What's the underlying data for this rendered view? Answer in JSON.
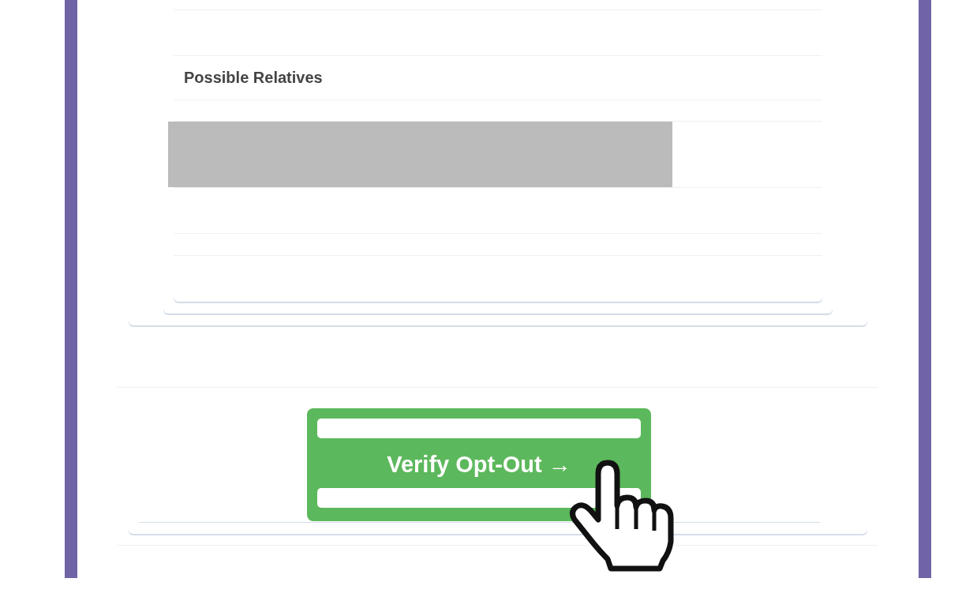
{
  "section": {
    "title": "Possible Relatives"
  },
  "button": {
    "label": "Verify Opt-Out →"
  }
}
